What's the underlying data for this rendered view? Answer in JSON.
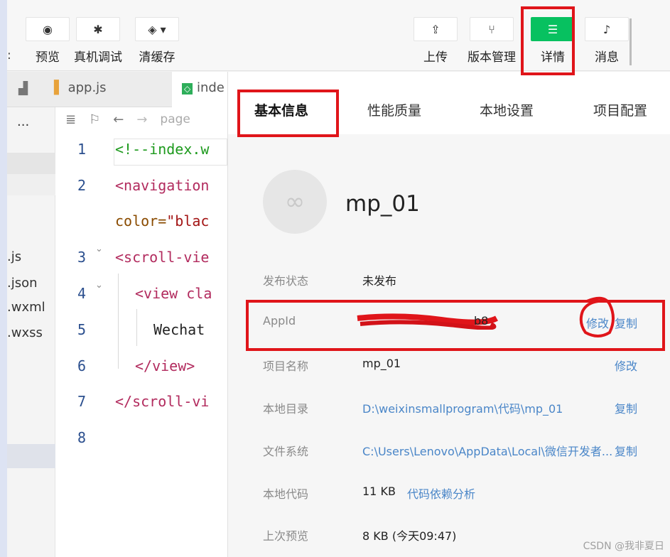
{
  "toolbar": {
    "left_fragment": ":",
    "items": [
      {
        "label": "预览",
        "icon": "eye-icon",
        "glyph": "◉"
      },
      {
        "label": "真机调试",
        "icon": "bug-icon",
        "glyph": "✱"
      },
      {
        "label": "清缓存",
        "icon": "layers-icon",
        "glyph": "◈ ▾"
      },
      {
        "label": "上传",
        "icon": "upload-icon",
        "glyph": "⇪"
      },
      {
        "label": "版本管理",
        "icon": "branch-icon",
        "glyph": "⑂"
      },
      {
        "label": "详情",
        "icon": "menu-icon",
        "glyph": "☰"
      },
      {
        "label": "消息",
        "icon": "bell-icon",
        "glyph": "♪"
      }
    ]
  },
  "tabs": [
    {
      "label": "app.js",
      "icon": "js-file-icon"
    },
    {
      "label": "inde",
      "icon": "wxml-file-icon"
    }
  ],
  "explorer": {
    "more": "...",
    "files": [
      ".js",
      ".json",
      ".wxml",
      ".wxss"
    ]
  },
  "editor": {
    "breadcrumb": "page",
    "lines": [
      {
        "no": "1",
        "text": "<!--index.w"
      },
      {
        "no": "2",
        "text": "<navigation"
      },
      {
        "no": "",
        "text_attr": "color=",
        "text_str": "\"blac"
      },
      {
        "no": "3",
        "text": "<scroll-vie"
      },
      {
        "no": "4",
        "text": "<view cla"
      },
      {
        "no": "5",
        "text": "Wechat"
      },
      {
        "no": "6",
        "text": "</view>"
      },
      {
        "no": "7",
        "text": "</scroll-vi"
      },
      {
        "no": "8",
        "text": ""
      }
    ]
  },
  "details": {
    "tabs": [
      "基本信息",
      "性能质量",
      "本地设置",
      "项目配置"
    ],
    "active_tab": "基本信息",
    "project_name": "mp_01",
    "rows": {
      "status": {
        "label": "发布状态",
        "value": "未发布"
      },
      "appid": {
        "label": "AppId",
        "value": "b8",
        "edit": "修改",
        "copy": "复制"
      },
      "name": {
        "label": "项目名称",
        "value": "mp_01",
        "edit": "修改"
      },
      "localdir": {
        "label": "本地目录",
        "value": "D:\\weixinsmallprogram\\代码\\mp_01",
        "copy": "复制"
      },
      "filesystem": {
        "label": "文件系统",
        "value": "C:\\Users\\Lenovo\\AppData\\Local\\微信开发者...",
        "copy": "复制"
      },
      "localcode": {
        "label": "本地代码",
        "value": "11 KB",
        "link": "代码依赖分析"
      },
      "lastpreview": {
        "label": "上次预览",
        "value": "8 KB (今天09:47)"
      }
    }
  },
  "watermark": "CSDN @我非夏日",
  "colors": {
    "accent_green": "#07c160",
    "annotation_red": "#e0151a",
    "link_blue": "#4a86c8"
  }
}
